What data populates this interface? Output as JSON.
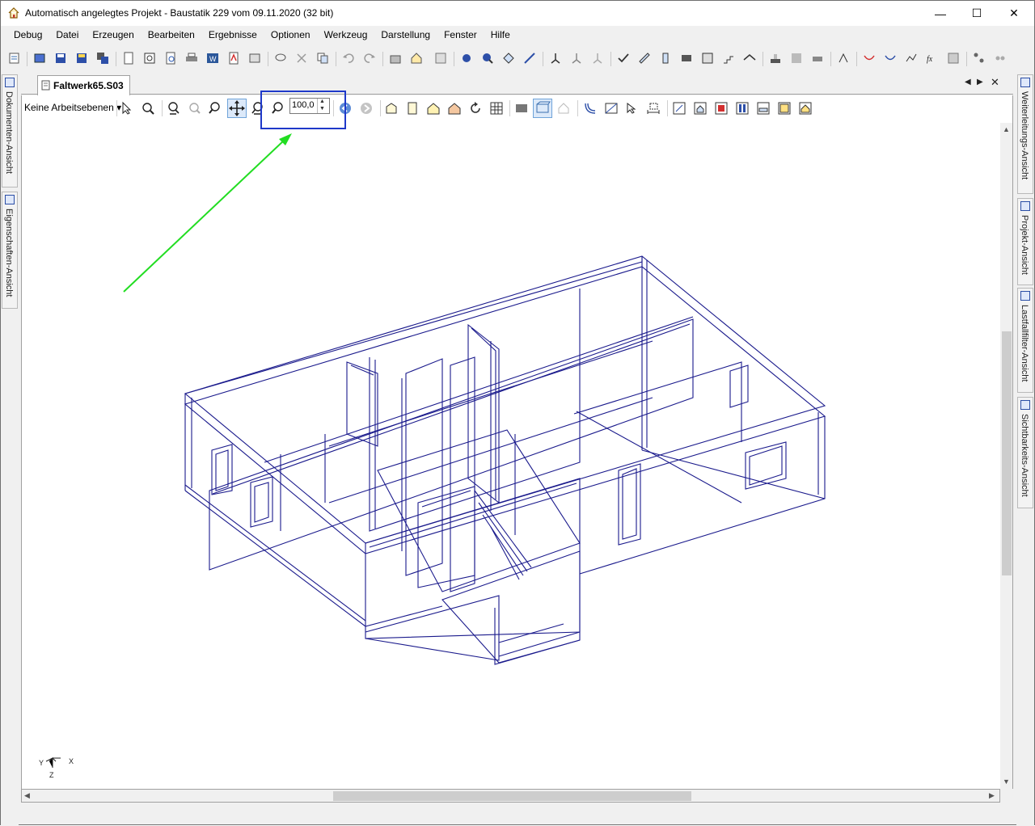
{
  "window": {
    "title": "Automatisch angelegtes Projekt - Baustatik 229 vom 09.11.2020 (32 bit)",
    "minimize": "—",
    "maximize": "☐",
    "close": "✕"
  },
  "menu": [
    "Debug",
    "Datei",
    "Erzeugen",
    "Bearbeiten",
    "Ergebnisse",
    "Optionen",
    "Werkzeug",
    "Darstellung",
    "Fenster",
    "Hilfe"
  ],
  "left_dock": {
    "tabs": [
      "Dokumenten-Ansicht",
      "Eigenschaften-Ansicht"
    ]
  },
  "right_dock": {
    "tabs": [
      "Weiterleitungs-Ansicht",
      "Projekt-Ansicht",
      "Lastfallfilter-Ansicht",
      "Sichtbarkeits-Ansicht"
    ]
  },
  "document": {
    "tab_label": "Faltwerk65.S03",
    "nav_prev": "◀",
    "nav_next": "▶",
    "close": "✕"
  },
  "view_toolbar": {
    "layer_dropdown": "Keine Arbeitsebenen ▾",
    "zoom_value": "100,0"
  },
  "axes": {
    "x": "X",
    "y": "Y",
    "z": "Z"
  },
  "colors": {
    "wireframe": "#1a1a8c",
    "annotation_arrow": "#22dd22",
    "highlight_box": "#1f39c9"
  }
}
